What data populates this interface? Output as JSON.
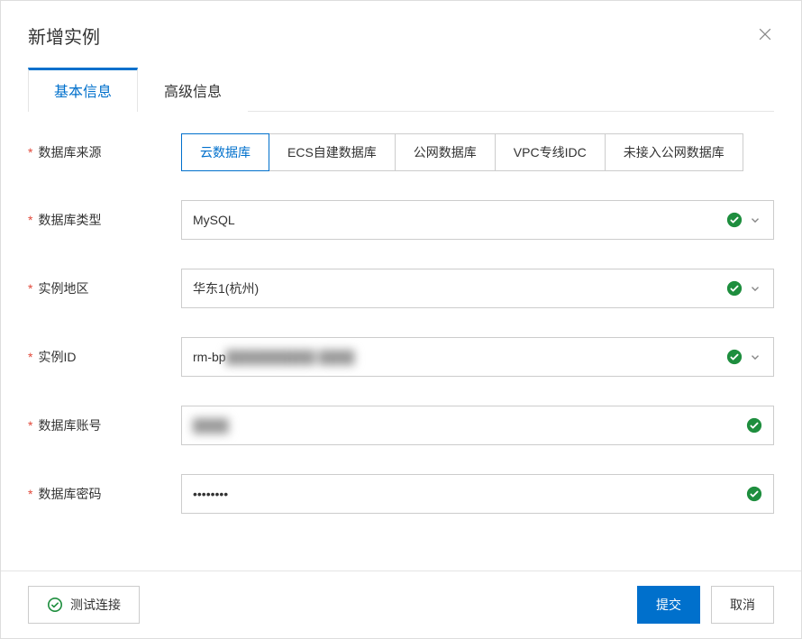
{
  "dialog": {
    "title": "新增实例"
  },
  "tabs": {
    "basic": "基本信息",
    "advanced": "高级信息"
  },
  "labels": {
    "source": "数据库来源",
    "dbtype": "数据库类型",
    "region": "实例地区",
    "instanceId": "实例ID",
    "account": "数据库账号",
    "password": "数据库密码"
  },
  "sourceOptions": {
    "cloud": "云数据库",
    "ecs": "ECS自建数据库",
    "public": "公网数据库",
    "vpc": "VPC专线IDC",
    "noPublic": "未接入公网数据库"
  },
  "values": {
    "dbtype": "MySQL",
    "region": "华东1(杭州)",
    "instanceIdPrefix": "rm-bp",
    "instanceIdMasked": "██████████ ████",
    "accountMasked": "████",
    "password": "••••••••"
  },
  "footer": {
    "test": "测试连接",
    "submit": "提交",
    "cancel": "取消"
  },
  "colors": {
    "primary": "#0070cc",
    "success": "#1e8e3e",
    "required": "#e24a3b"
  }
}
